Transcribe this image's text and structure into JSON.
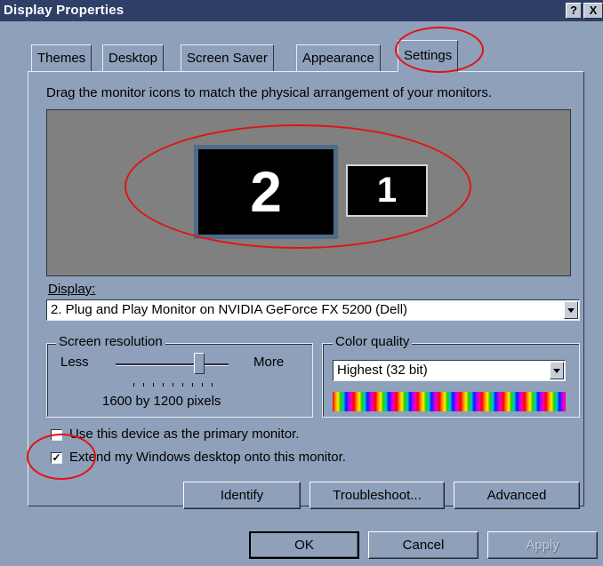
{
  "window": {
    "title": "Display Properties"
  },
  "title_buttons": {
    "help": "?",
    "close": "X"
  },
  "tabs": [
    "Themes",
    "Desktop",
    "Screen Saver",
    "Appearance",
    "Settings"
  ],
  "active_tab": "Settings",
  "instruction": "Drag the monitor icons to match the physical arrangement of your monitors.",
  "monitors": [
    {
      "number": "2"
    },
    {
      "number": "1"
    }
  ],
  "display": {
    "label": "Display:",
    "value": "2. Plug and Play Monitor on NVIDIA GeForce FX 5200 (Dell)"
  },
  "resolution": {
    "group_label": "Screen resolution",
    "less": "Less",
    "more": "More",
    "value_text": "1600 by 1200 pixels",
    "slider_position": 0.72
  },
  "color_quality": {
    "group_label": "Color quality",
    "value": "Highest (32 bit)"
  },
  "checkboxes": [
    {
      "label": "Use this device as the primary monitor.",
      "checked": false
    },
    {
      "label": "Extend my Windows desktop onto this monitor.",
      "checked": true
    }
  ],
  "buttons": {
    "identify": "Identify",
    "troubleshoot": "Troubleshoot...",
    "advanced": "Advanced",
    "ok": "OK",
    "cancel": "Cancel",
    "apply": "Apply"
  },
  "colors": {
    "highlight_annotation": "#e01414",
    "titlebar": "#2e3f68"
  }
}
